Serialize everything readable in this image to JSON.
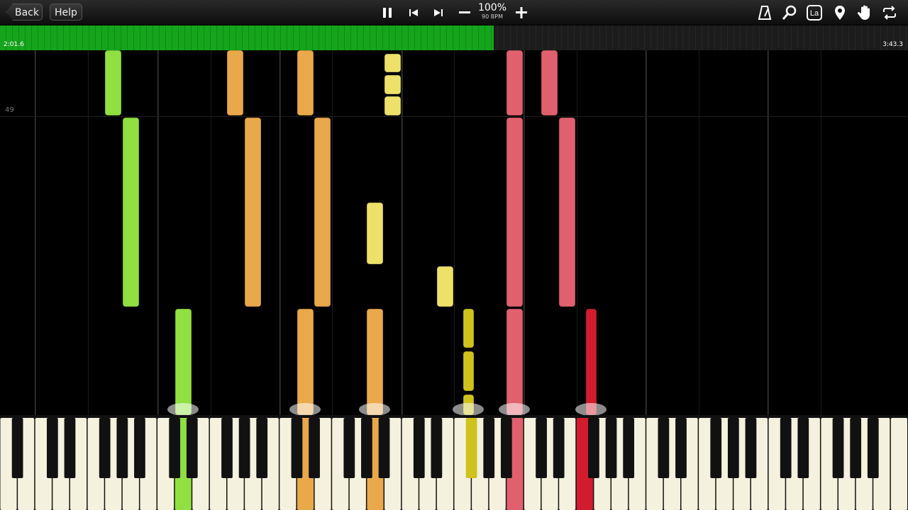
{
  "toolbar": {
    "back_label": "Back",
    "help_label": "Help",
    "speed_percent": "100%",
    "tempo": "90 BPM",
    "icons": [
      "pause-icon",
      "skip-back-icon",
      "skip-forward-icon",
      "minus-icon",
      "plus-icon",
      "metronome-icon",
      "search-icon",
      "label-la-icon",
      "location-pin-icon",
      "hand-icon",
      "loop-icon"
    ],
    "label_icon_text": "La"
  },
  "progress": {
    "current_time": "2:01.6",
    "total_time": "3:43.3",
    "fraction": 0.544,
    "color": "#15a51c"
  },
  "roll": {
    "measure_number": "49"
  },
  "colors": {
    "green": "#8fe040",
    "orange": "#e9a84a",
    "yellow": "#ede16a",
    "olive": "#cfc21c",
    "pink": "#e0606e",
    "red": "#d21c2e"
  }
}
